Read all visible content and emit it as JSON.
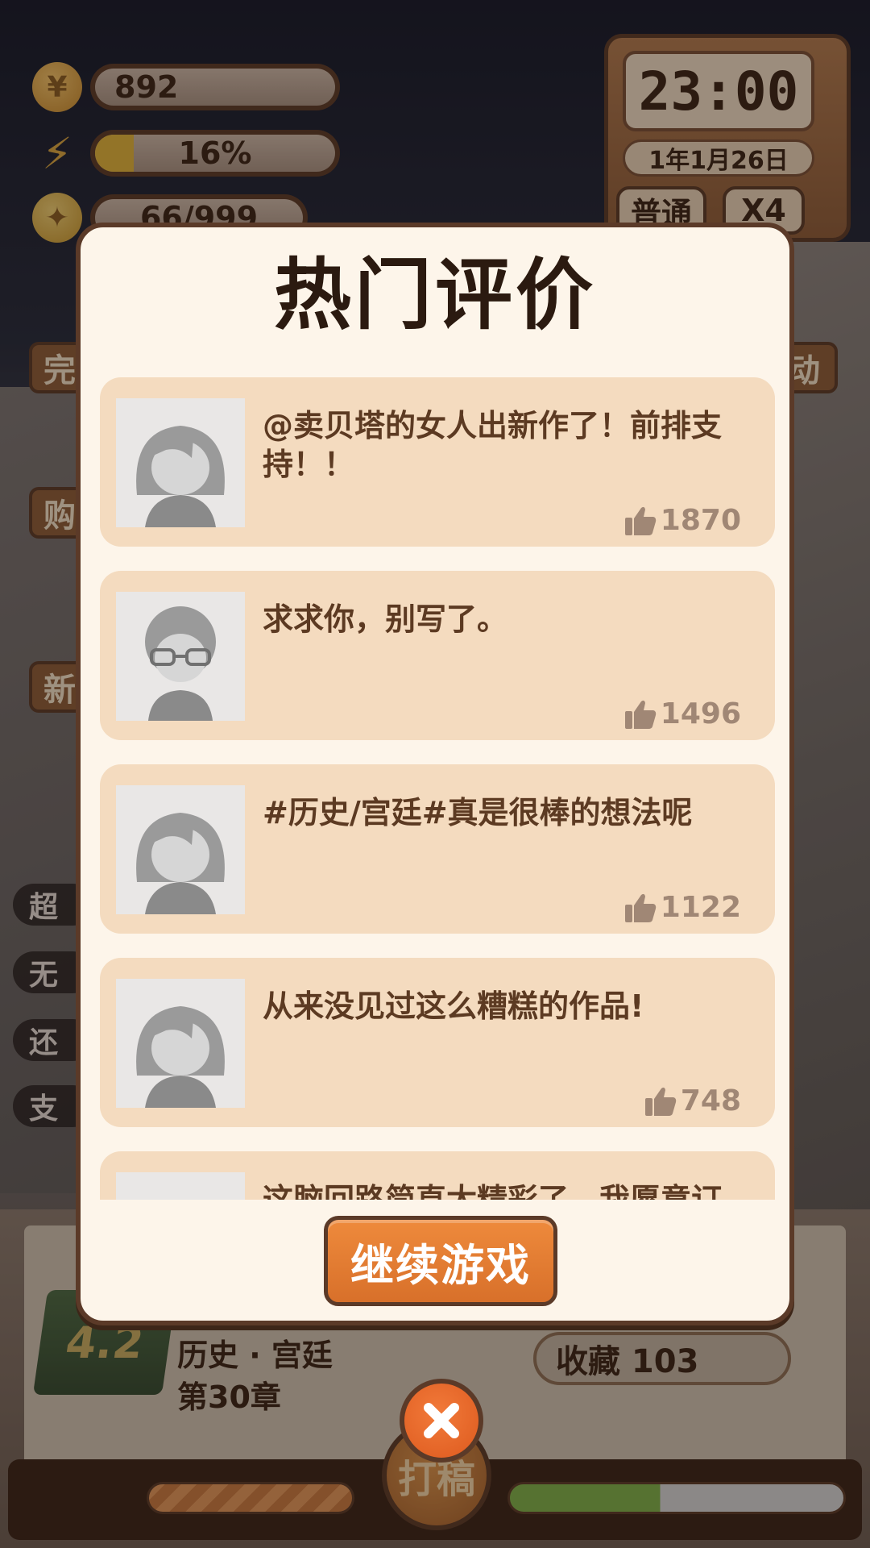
{
  "hud": {
    "coins": "892",
    "energy": "16%",
    "energy_fraction": 0.16,
    "inspiration": "66/999"
  },
  "clock": {
    "time": "23:00",
    "date": "1年1月26日",
    "mode": "普通",
    "speed": "X4"
  },
  "side": {
    "tab_done": "完",
    "tab_activity": "动",
    "tab_shop": "购",
    "tab_new": "新",
    "labels": [
      "超",
      "无",
      "还",
      "支"
    ]
  },
  "book": {
    "rating": "4.2",
    "genre": "历史 · 宫廷",
    "chapter": "第30章",
    "favorites_label": "收藏 103",
    "draft_label": "打稿"
  },
  "modal": {
    "title": "热门评价",
    "continue_label": "继续游戏",
    "comments": [
      {
        "text": "@卖贝塔的女人出新作了！前排支持！！",
        "likes": "1870",
        "avatar": "girl-avatar-icon"
      },
      {
        "text": "求求你，别写了。",
        "likes": "1496",
        "avatar": "boy-glasses-avatar-icon"
      },
      {
        "text": "#历史/宫廷#真是很棒的想法呢",
        "likes": "1122",
        "avatar": "girl-avatar-icon"
      },
      {
        "text": "从来没见过这么糟糕的作品!",
        "likes": "748",
        "avatar": "girl-avatar-icon"
      },
      {
        "text": "这脑回路简直太精彩了，我愿意订",
        "likes": "",
        "avatar": "girl-avatar-icon"
      }
    ]
  },
  "colors": {
    "modal_bg": "#fdf5ea",
    "card_bg": "#f4dbbf",
    "border": "#5b3a28",
    "accent_orange": "#e9803a"
  }
}
